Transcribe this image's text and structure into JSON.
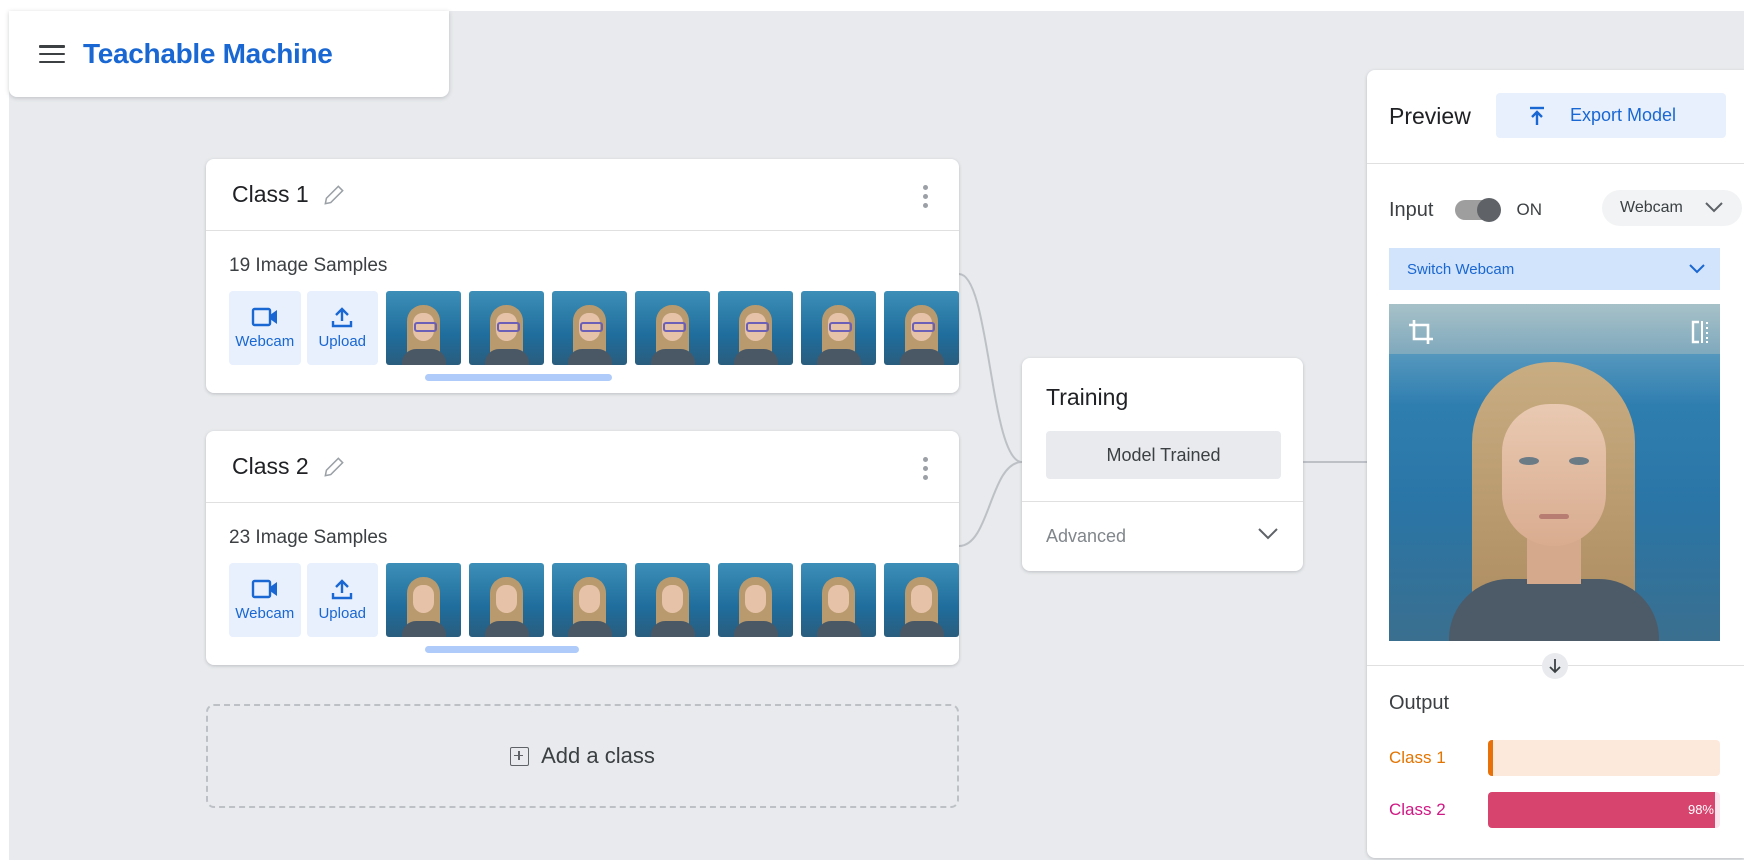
{
  "app": {
    "title": "Teachable Machine"
  },
  "classes": [
    {
      "name": "Class 1",
      "sample_count": "19 Image Samples",
      "webcam_label": "Webcam",
      "upload_label": "Upload",
      "scroll_fraction": 0.45,
      "thumbnail_count_visible": 7,
      "thumb_style": "glasses"
    },
    {
      "name": "Class 2",
      "sample_count": "23 Image Samples",
      "webcam_label": "Webcam",
      "upload_label": "Upload",
      "scroll_fraction": 0.37,
      "thumbnail_count_visible": 7,
      "thumb_style": "plain"
    }
  ],
  "add_class": {
    "label": "Add a class"
  },
  "training": {
    "title": "Training",
    "status_button": "Model Trained",
    "advanced_label": "Advanced"
  },
  "preview": {
    "title": "Preview",
    "export_label": "Export Model",
    "input_label": "Input",
    "toggle_state": "ON",
    "source_select": "Webcam",
    "switch_webcam_label": "Switch Webcam",
    "output_label": "Output",
    "outputs": [
      {
        "name": "Class 1",
        "color": "#e37400",
        "track_color": "#fde9dc",
        "fill_color": "#e8710a",
        "value": 0.02,
        "pct_label": ""
      },
      {
        "name": "Class 2",
        "color": "#d01884",
        "track_color": "#fce4ec",
        "fill_color": "#d7456f",
        "value": 0.98,
        "pct_label": "98%"
      }
    ]
  },
  "colors": {
    "accent": "#1967d2",
    "canvas": "#e8eaed",
    "button_bg": "#e8f0fe"
  },
  "icons": [
    "menu-icon",
    "pencil-icon",
    "more-vert-icon",
    "videocam-icon",
    "upload-icon",
    "add-box-icon",
    "chevron-down-icon",
    "export-icon",
    "crop-icon",
    "flip-icon",
    "arrow-down-icon"
  ]
}
